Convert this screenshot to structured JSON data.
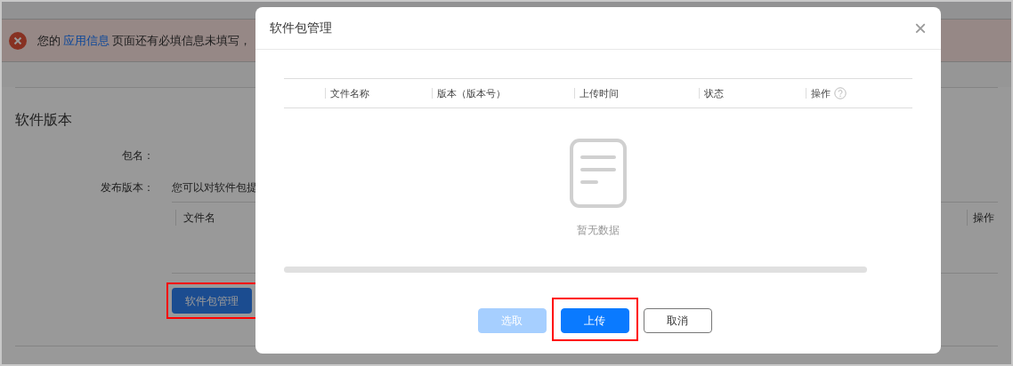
{
  "banner": {
    "prefix": "您的",
    "link": "应用信息",
    "suffix": "页面还有必填信息未填写，"
  },
  "page": {
    "section_title": "软件版本",
    "fields": [
      {
        "label": "包名："
      },
      {
        "label": "发布版本：",
        "value": "您可以对软件包提"
      }
    ],
    "table": {
      "columns": [
        "文件名",
        "操作"
      ]
    },
    "button": {
      "label": "软件包管理",
      "highlighted": true
    }
  },
  "modal": {
    "title": "软件包管理",
    "close": "×",
    "columns": [
      {
        "label": "文件名称"
      },
      {
        "label": "版本（版本号）"
      },
      {
        "label": "上传时间"
      },
      {
        "label": "状态"
      },
      {
        "label": "操作",
        "help": true
      }
    ],
    "empty_text": "暂无数据",
    "buttons": [
      {
        "label": "选取",
        "kind": "primary",
        "disabled": true,
        "highlighted": false
      },
      {
        "label": "上传",
        "kind": "primary",
        "disabled": false,
        "highlighted": true
      },
      {
        "label": "取消",
        "kind": "outline",
        "disabled": false,
        "highlighted": false
      }
    ]
  }
}
